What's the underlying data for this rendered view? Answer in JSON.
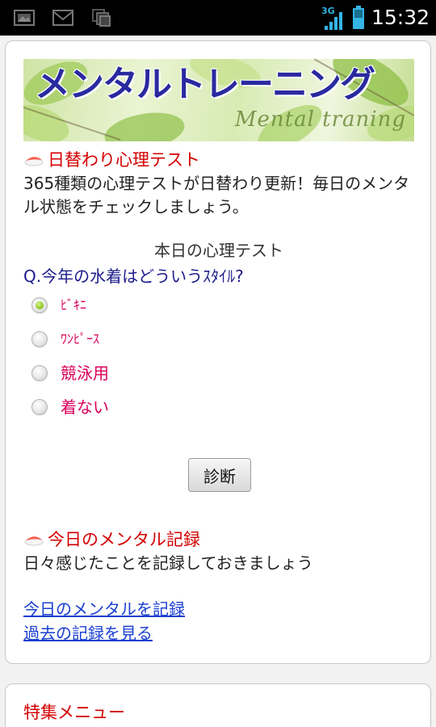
{
  "status_bar": {
    "time": "15:32",
    "network": "3G",
    "left_icons": [
      "gallery-icon",
      "mail-icon",
      "stack-icon"
    ],
    "right_icons": [
      "signal-icon",
      "battery-icon"
    ]
  },
  "banner": {
    "title": "メンタルトレーニング",
    "subtitle": "Mental traning"
  },
  "daily_test": {
    "heading": "日替わり心理テスト",
    "description": "365種類の心理テストが日替わり更新！毎日のメンタル状態をチェックしましょう。",
    "today_label": "本日の心理テスト",
    "question": "Q.今年の水着はどういうｽﾀｲﾙ?",
    "options": [
      {
        "label": "ﾋﾞｷﾆ",
        "selected": true
      },
      {
        "label": "ﾜﾝﾋﾟｰｽ",
        "selected": false
      },
      {
        "label": "競泳用",
        "selected": false
      },
      {
        "label": "着ない",
        "selected": false
      }
    ],
    "submit_label": "診断"
  },
  "mental_record": {
    "heading": "今日のメンタル記録",
    "description": "日々感じたことを記録しておきましょう",
    "links": [
      "今日のメンタルを記録",
      "過去の記録を見る"
    ]
  },
  "special_menu": {
    "heading": "特集メニュー"
  },
  "colors": {
    "heading": "#d40000",
    "question": "#1c1c8c",
    "option": "#d8005a",
    "link": "#1a3fd0",
    "status_accent": "#33b5e5"
  }
}
